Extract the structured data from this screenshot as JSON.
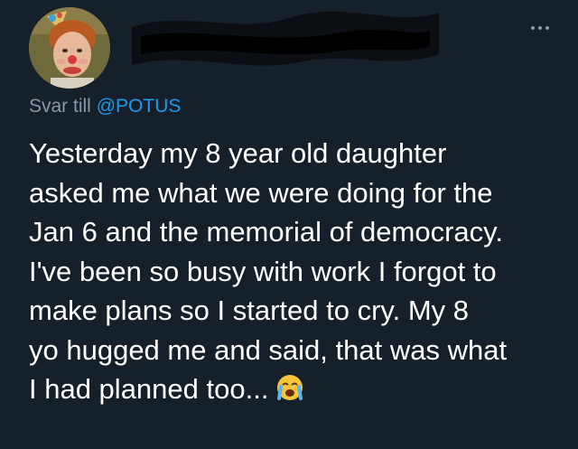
{
  "tweet": {
    "reply_prefix": "Svar till",
    "reply_handle": "@POTUS",
    "lines": [
      "Yesterday my 8 year old daughter",
      "asked me what we were doing for the",
      "Jan 6 and the memorial of democracy.",
      "I've been so busy with work I forgot to",
      "make plans so I started to cry. My 8",
      "yo hugged me and said, that was what",
      "I had planned too..."
    ],
    "emoji": "loudly-crying-face-icon"
  },
  "colors": {
    "background": "#15202b",
    "text": "#ffffff",
    "muted": "#8899a6",
    "link": "#1d9bf0"
  }
}
